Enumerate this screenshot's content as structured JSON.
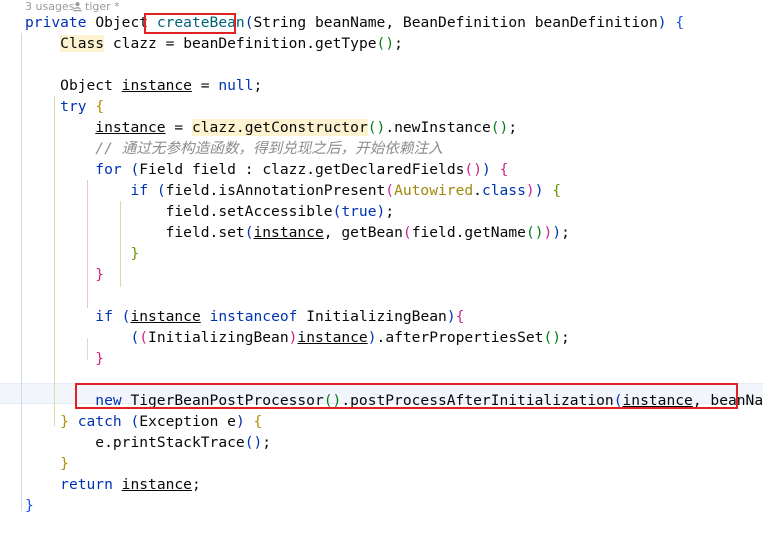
{
  "editor": {
    "app": "code-editor",
    "language": "java",
    "background": "#ffffff",
    "font_size_px": 14.6,
    "line_height_px": 21
  },
  "header": {
    "usages_label": "3 usages",
    "author_label": "tiger *",
    "author_icon": "person-icon"
  },
  "gutter": {
    "bulb_icon": "lightbulb-icon",
    "bulb_color": "#ffb02e",
    "bulb_line": 18
  },
  "highlights": {
    "caret_line_color": "#f2f6fc",
    "search_box_color": "#e02222",
    "identifier_highlight_color": "#fdf3d0",
    "boxes": [
      {
        "name": "createBean-call-box",
        "text": "createBean("
      },
      {
        "name": "post-processor-line-box",
        "text": "new TigerBeanPostProcessor().postProcessAfterInitialization(instance, beanName);"
      }
    ]
  },
  "colors": {
    "keyword": "#0033b3",
    "string": "#067d17",
    "comment": "#8c8c8c",
    "annotation": "#9e880d",
    "method_declaration": "#00627a",
    "field": "#871094",
    "paren_level1": "#0033b3",
    "paren_level2": "#cc2389",
    "paren_level3": "#067d17",
    "brace_level1": "#1750eb",
    "brace_level2": "#b09000",
    "brace_level3": "#cc2389",
    "brace_level4": "#6a9500"
  },
  "code": {
    "lines": [
      "private Object createBean(String beanName, BeanDefinition beanDefinition) {",
      "    Class clazz = beanDefinition.getType();",
      "",
      "    Object instance = null;",
      "    try {",
      "        instance = clazz.getConstructor().newInstance();",
      "        // 通过无参构造函数，得到兑现之后，开始依赖注入",
      "        for (Field field : clazz.getDeclaredFields()) {",
      "            if (field.isAnnotationPresent(Autowired.class)) {",
      "                field.setAccessible(true);",
      "                field.set(instance, getBean(field.getName()));",
      "            }",
      "        }",
      "",
      "        if (instance instanceof InitializingBean){",
      "            ((InitializingBean)instance).afterPropertiesSet();",
      "        }",
      "",
      "        new TigerBeanPostProcessor().postProcessAfterInitialization(instance, beanName);",
      "    } catch (Exception e) {",
      "        e.printStackTrace();",
      "    }",
      "    return instance;",
      "}"
    ],
    "comment_text": "// 通过无参构造函数，得到兑现之后，开始依赖注入"
  }
}
